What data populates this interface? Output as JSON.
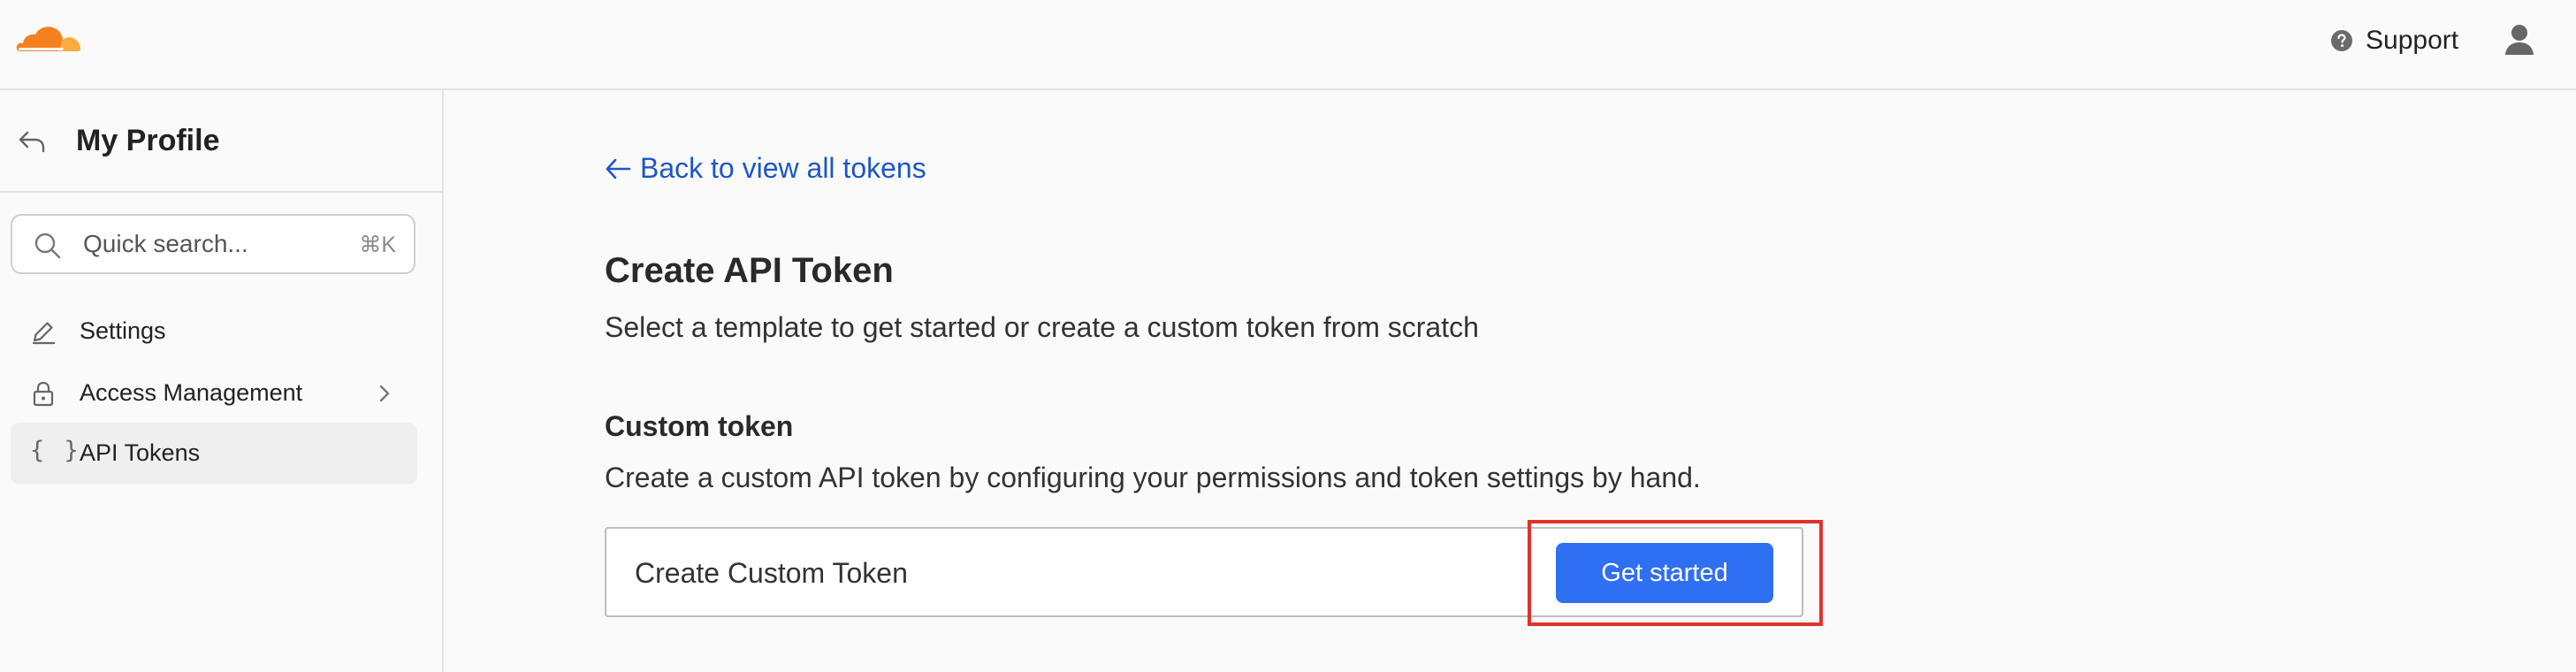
{
  "header": {
    "logo_alt": "Cloudflare",
    "support_label": "Support",
    "user_icon": "user-icon",
    "help_icon": "help-circle-icon",
    "brand_orange": "#f48120"
  },
  "sidebar": {
    "back_icon": "undo-arrow-icon",
    "title": "My Profile",
    "search": {
      "placeholder": "Quick search...",
      "shortcut": "⌘K"
    },
    "items": [
      {
        "label": "Settings",
        "icon": "pencil-icon",
        "active": false
      },
      {
        "label": "Access Management",
        "icon": "lock-icon",
        "active": false,
        "has_chevron": true
      },
      {
        "label": "API Tokens",
        "icon": "braces-icon",
        "icon_glyph": "{ }",
        "active": true
      }
    ]
  },
  "main": {
    "back_link": "Back to view all tokens",
    "heading": "Create API Token",
    "subtitle": "Select a template to get started or create a custom token from scratch",
    "custom_token": {
      "heading": "Custom token",
      "description": "Create a custom API token by configuring your permissions and token settings by hand.",
      "card_title": "Create Custom Token",
      "button_label": "Get started"
    }
  },
  "colors": {
    "link": "#1e57c4",
    "primary_button": "#2f6ff2",
    "highlight": "#e0332b"
  }
}
